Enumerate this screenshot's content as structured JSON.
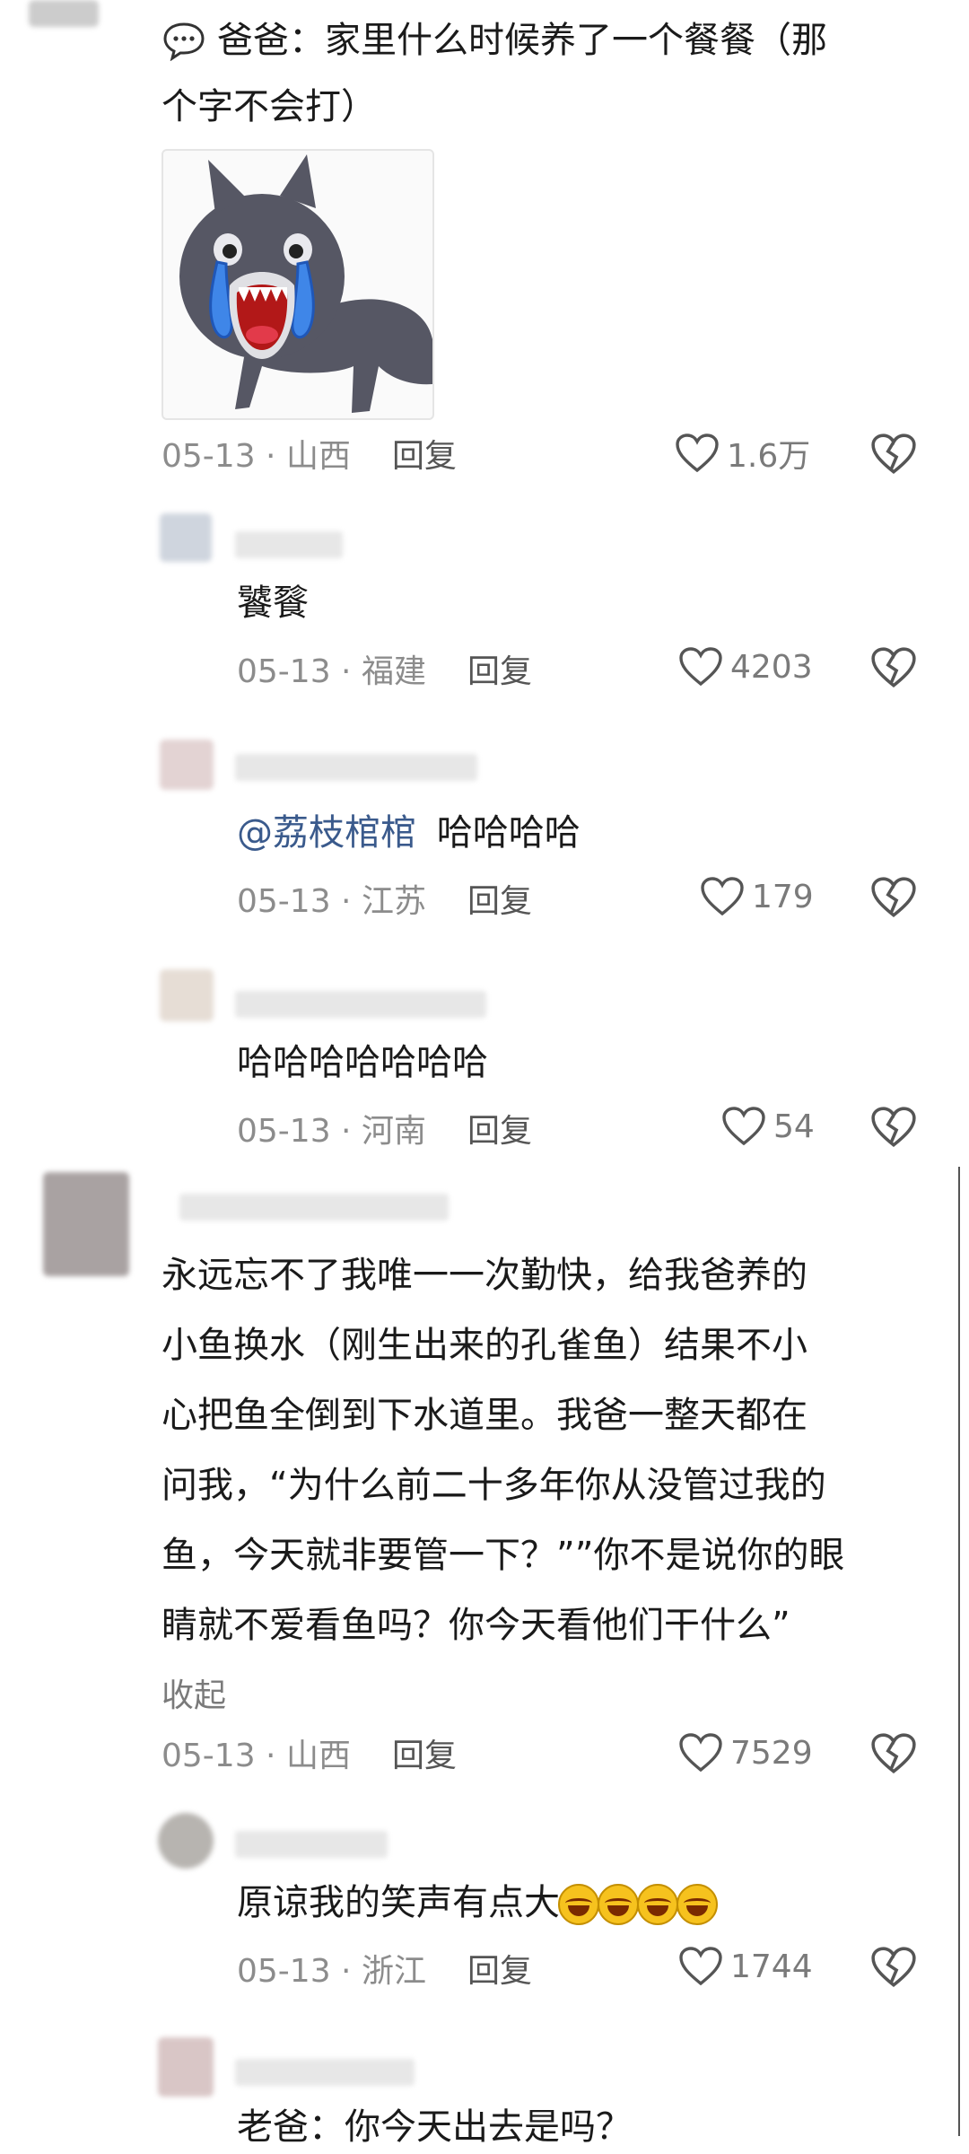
{
  "comments": [
    {
      "icon": "speech-bubble-icon",
      "text": "爸爸：家里什么时候养了一个餐餐（那个字不会打）",
      "line1": "爸爸：家里什么时候养了一个餐餐（那",
      "line2": "个字不会打）",
      "sticker": "crying-cat-sticker",
      "date": "05-13 · 山西",
      "reply": "回复",
      "likes": "1.6万",
      "replies": [
        {
          "text": "饕餮",
          "date": "05-13 · 福建",
          "reply": "回复",
          "likes": "4203"
        },
        {
          "mention": "@荔枝棺棺",
          "text": "哈哈哈哈",
          "date": "05-13 · 江苏",
          "reply": "回复",
          "likes": "179"
        },
        {
          "text": "哈哈哈哈哈哈哈",
          "date": "05-13 · 河南",
          "reply": "回复",
          "likes": "54"
        }
      ]
    },
    {
      "lines": [
        "永远忘不了我唯一一次勤快，给我爸养的",
        "小鱼换水（刚生出来的孔雀鱼）结果不小",
        "心把鱼全倒到下水道里。我爸一整天都在",
        "问我，“为什么前二十多年你从没管过我的",
        "鱼，今天就非要管一下？””你不是说你的眼",
        "睛就不爱看鱼吗？你今天看他们干什么”"
      ],
      "collapse": "收起",
      "date": "05-13 · 山西",
      "reply": "回复",
      "likes": "7529",
      "replies": [
        {
          "text": "原谅我的笑声有点大",
          "emoji_count": 4,
          "date": "05-13 · 浙江",
          "reply": "回复",
          "likes": "1744"
        },
        {
          "text": "老爸：你今天出去是吗？"
        }
      ]
    }
  ]
}
